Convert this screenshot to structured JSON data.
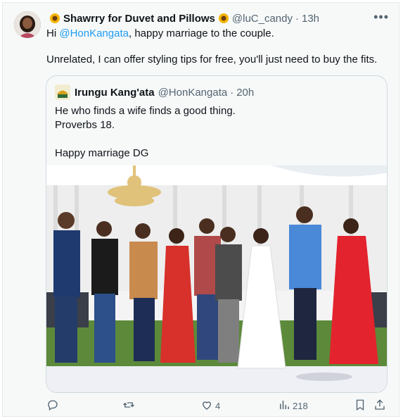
{
  "tweet": {
    "display_name": "Shawrry for Duvet and Pillows",
    "handle": "@luC_candy",
    "time_sep": "·",
    "time": "13h",
    "line1_prefix": "Hi ",
    "line1_mention": "@HonKangata",
    "line1_suffix": ", happy marriage to the couple.",
    "line2": "Unrelated, I can offer styling tips for free, you'll just need to buy the fits.",
    "more_icon": "•••"
  },
  "quote": {
    "display_name": "Irungu Kang'ata",
    "handle": "@HonKangata",
    "time_sep": "·",
    "time": "20h",
    "text": "He who finds a wife finds a good thing.\nProverbs 18.\n\nHappy marriage DG"
  },
  "actions": {
    "reply_count": "",
    "retweet_count": "",
    "like_count": "4",
    "views_count": "218"
  },
  "colors": {
    "link": "#1d9bf0",
    "muted": "#536471",
    "background": "#f7f9f9",
    "border": "#cfd9de"
  },
  "icons": [
    "reply-icon",
    "retweet-icon",
    "like-icon",
    "views-icon",
    "bookmark-icon",
    "share-icon",
    "sunflower-emoji-icon",
    "more-icon"
  ]
}
